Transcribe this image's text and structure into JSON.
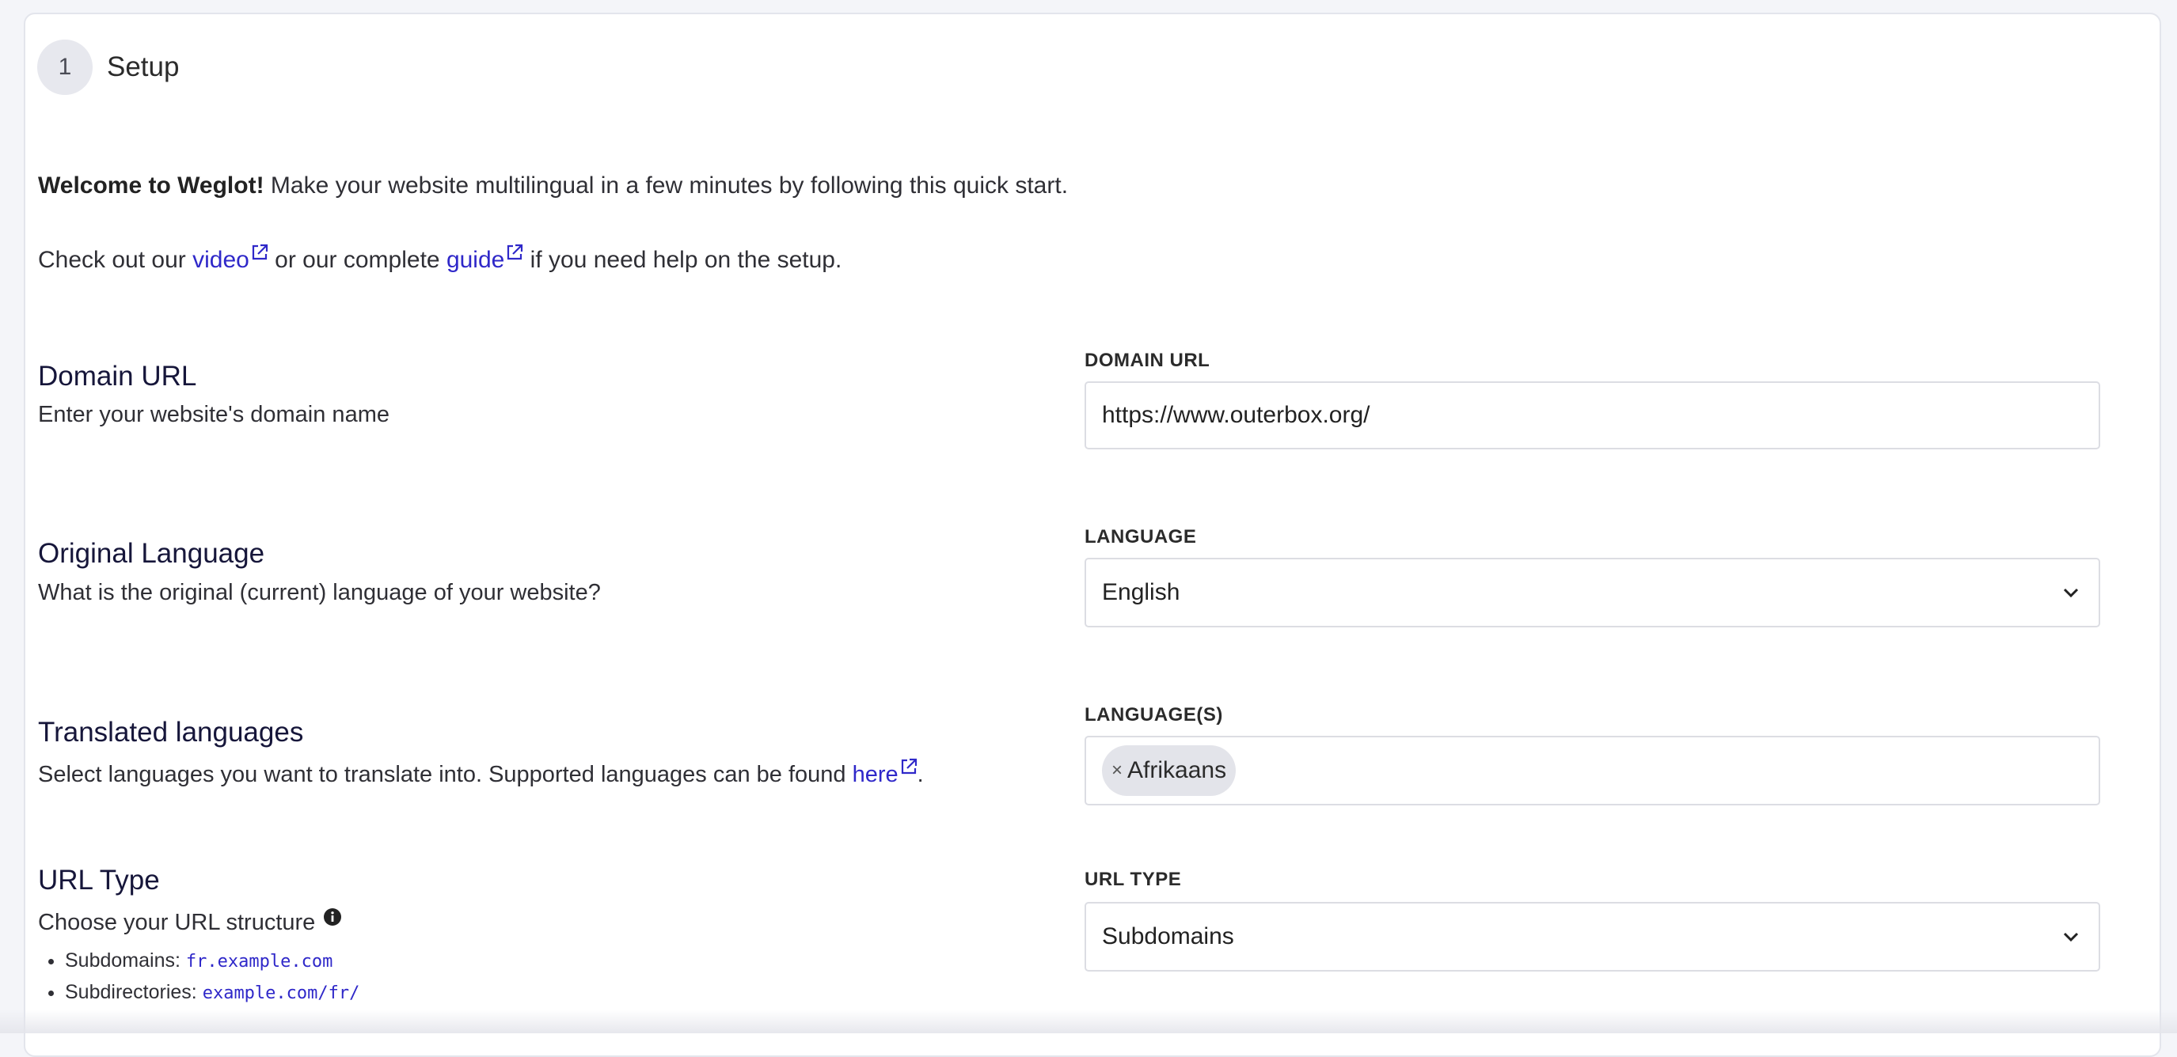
{
  "step": {
    "number": "1",
    "title": "Setup"
  },
  "intro": {
    "welcome_bold": "Welcome to Weglot!",
    "welcome_rest": " Make your website multilingual in a few minutes by following this quick start.",
    "help_prefix": "Check out our ",
    "video_link": "video",
    "help_middle": " or our complete ",
    "guide_link": "guide",
    "help_suffix": " if you need help on the setup."
  },
  "domain": {
    "title": "Domain URL",
    "description": "Enter your website's domain name",
    "label": "DOMAIN URL",
    "value": "https://www.outerbox.org/"
  },
  "original_language": {
    "title": "Original Language",
    "description": "What is the original (current) language of your website?",
    "label": "LANGUAGE",
    "selected": "English"
  },
  "translated_languages": {
    "title": "Translated languages",
    "description_prefix": "Select languages you want to translate into. Supported languages can be found ",
    "here_link": "here",
    "description_suffix": ".",
    "label": "LANGUAGE(S)",
    "tags": [
      "Afrikaans"
    ],
    "tag_remove": "×"
  },
  "url_type": {
    "title": "URL Type",
    "description": "Choose your URL structure",
    "label": "URL TYPE",
    "selected": "Subdomains",
    "options_help": [
      {
        "name": "Subdomains:",
        "example": "fr.example.com"
      },
      {
        "name": "Subdirectories:",
        "example": "example.com/fr/"
      }
    ]
  },
  "colors": {
    "link": "#2f28c9",
    "heading": "#16163a",
    "border": "#dcdde3"
  },
  "icons": {
    "external_link": "external-link-icon",
    "chevron": "chevron-down-icon",
    "info": "info-icon"
  }
}
